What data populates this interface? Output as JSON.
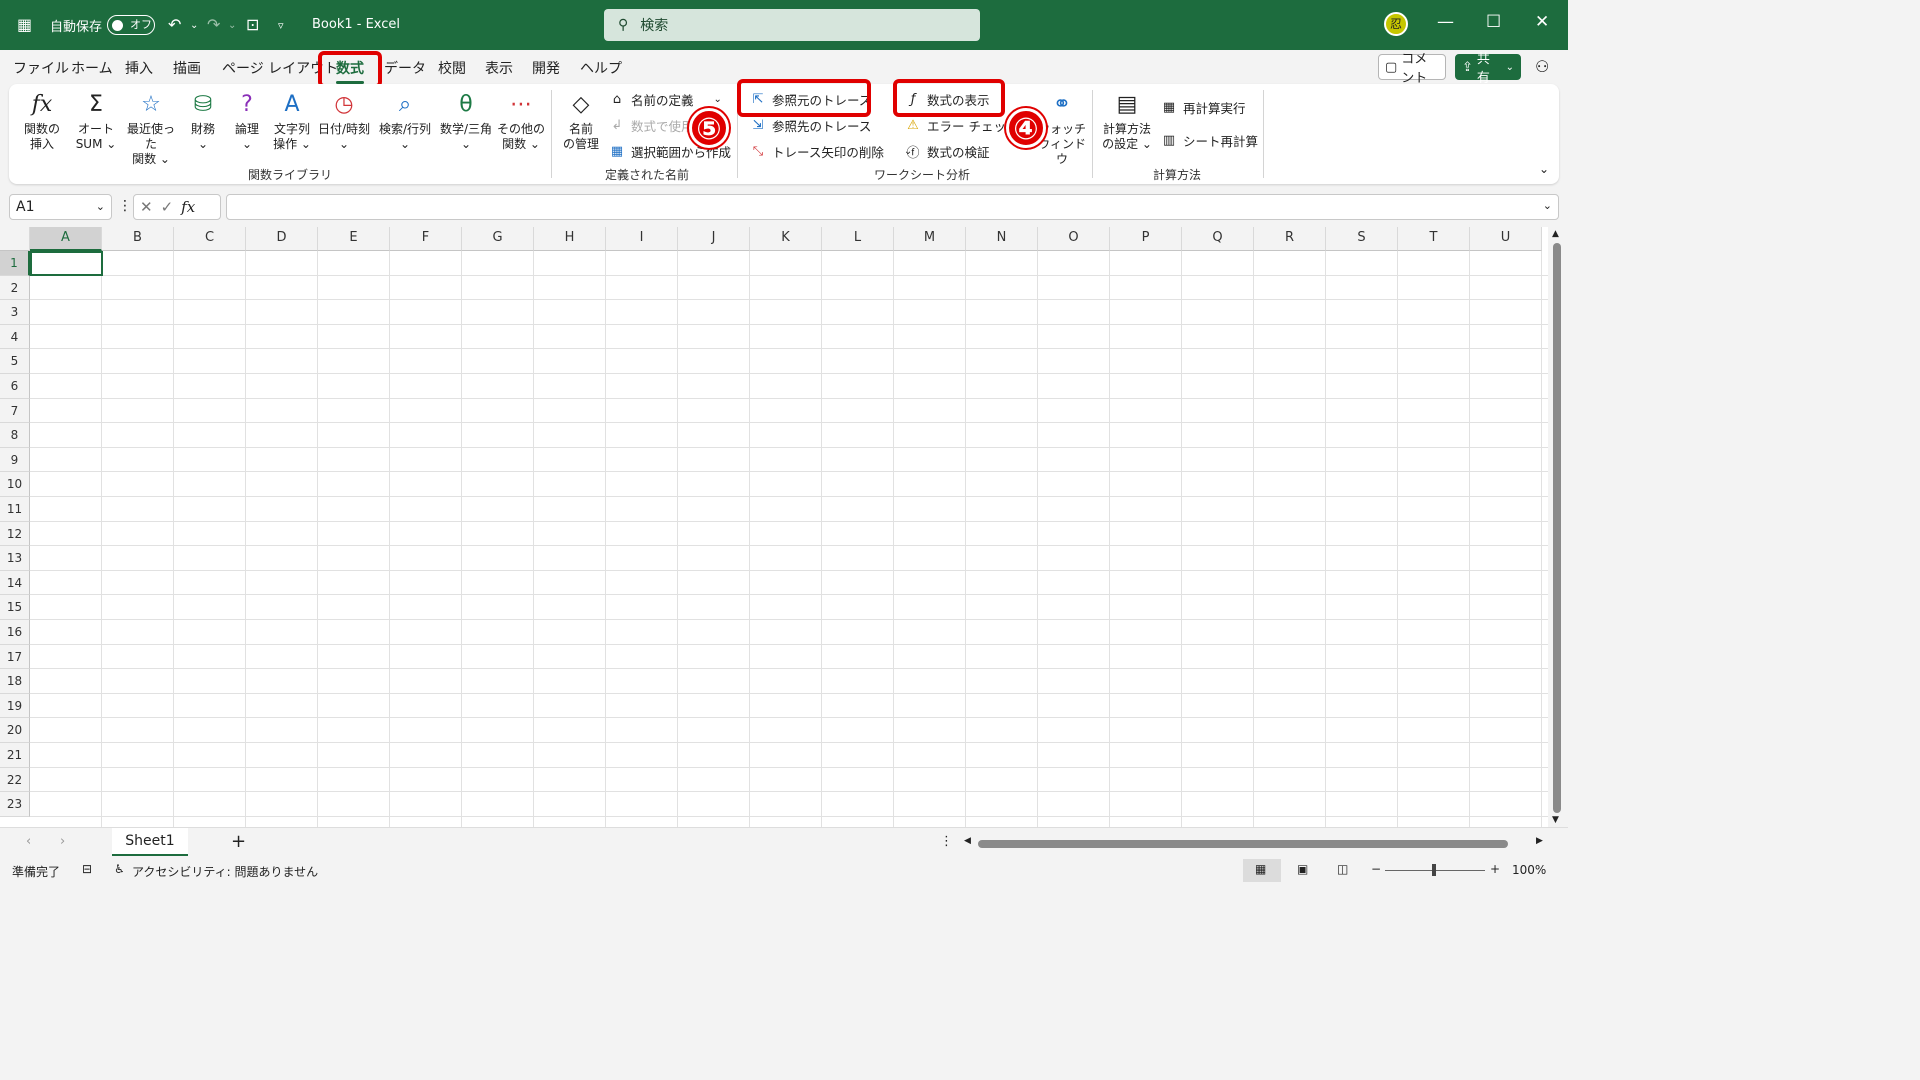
{
  "titlebar": {
    "autosave_label": "自動保存",
    "autosave_state": "オフ",
    "doc_title": "Book1  -  Excel",
    "search_placeholder": "検索",
    "avatar_text": "忍"
  },
  "menu": {
    "items": [
      "ファイル",
      "ホーム",
      "挿入",
      "描画",
      "ページ レイアウト",
      "数式",
      "データ",
      "校閲",
      "表示",
      "開発",
      "ヘルプ"
    ],
    "active": "数式",
    "comment_label": "コメント",
    "share_label": "共有"
  },
  "ribbon": {
    "function_library": {
      "label": "関数ライブラリ",
      "buttons": [
        {
          "label1": "関数の",
          "label2": "挿入"
        },
        {
          "label1": "オート",
          "label2": "SUM ⌄"
        },
        {
          "label1": "最近使った",
          "label2": "関数 ⌄"
        },
        {
          "label1": "財務",
          "label2": "⌄"
        },
        {
          "label1": "論理",
          "label2": "⌄"
        },
        {
          "label1": "文字列",
          "label2": "操作 ⌄"
        },
        {
          "label1": "日付/時刻",
          "label2": "⌄"
        },
        {
          "label1": "検索/行列",
          "label2": "⌄"
        },
        {
          "label1": "数学/三角",
          "label2": "⌄"
        },
        {
          "label1": "その他の",
          "label2": "関数 ⌄"
        }
      ]
    },
    "defined_names": {
      "label": "定義された名前",
      "manager_label1": "名前",
      "manager_label2": "の管理",
      "define_name": "名前の定義",
      "use_in_formula": "数式で使用",
      "create_from_selection": "選択範囲から作成"
    },
    "formula_auditing": {
      "label": "ワークシート分析",
      "trace_precedents": "参照元のトレース",
      "trace_dependents": "参照先のトレース",
      "remove_arrows": "トレース矢印の削除",
      "show_formulas": "数式の表示",
      "error_checking": "エラー チェック",
      "evaluate_formula": "数式の検証",
      "watch_window1": "ウォッチ",
      "watch_window2": "ウィンドウ"
    },
    "calculation": {
      "label": "計算方法",
      "options1": "計算方法",
      "options2": "の設定 ⌄",
      "calc_now": "再計算実行",
      "calc_sheet": "シート再計算"
    },
    "badges": {
      "four": "④",
      "five": "⑤"
    }
  },
  "formula_bar": {
    "name_box": "A1",
    "fx": "fx",
    "content": ""
  },
  "grid": {
    "columns": [
      "A",
      "B",
      "C",
      "D",
      "E",
      "F",
      "G",
      "H",
      "I",
      "J",
      "K",
      "L",
      "M",
      "N",
      "O",
      "P",
      "Q",
      "R",
      "S",
      "T",
      "U"
    ],
    "rows": [
      "1",
      "2",
      "3",
      "4",
      "5",
      "6",
      "7",
      "8",
      "9",
      "10",
      "11",
      "12",
      "13",
      "14",
      "15",
      "16",
      "17",
      "18",
      "19",
      "20",
      "21",
      "22",
      "23"
    ],
    "selected_cell": "A1"
  },
  "sheets": {
    "tabs": [
      "Sheet1"
    ],
    "add_label": "+"
  },
  "status": {
    "ready": "準備完了",
    "accessibility": "アクセシビリティ: 問題ありません",
    "zoom": "100%"
  }
}
